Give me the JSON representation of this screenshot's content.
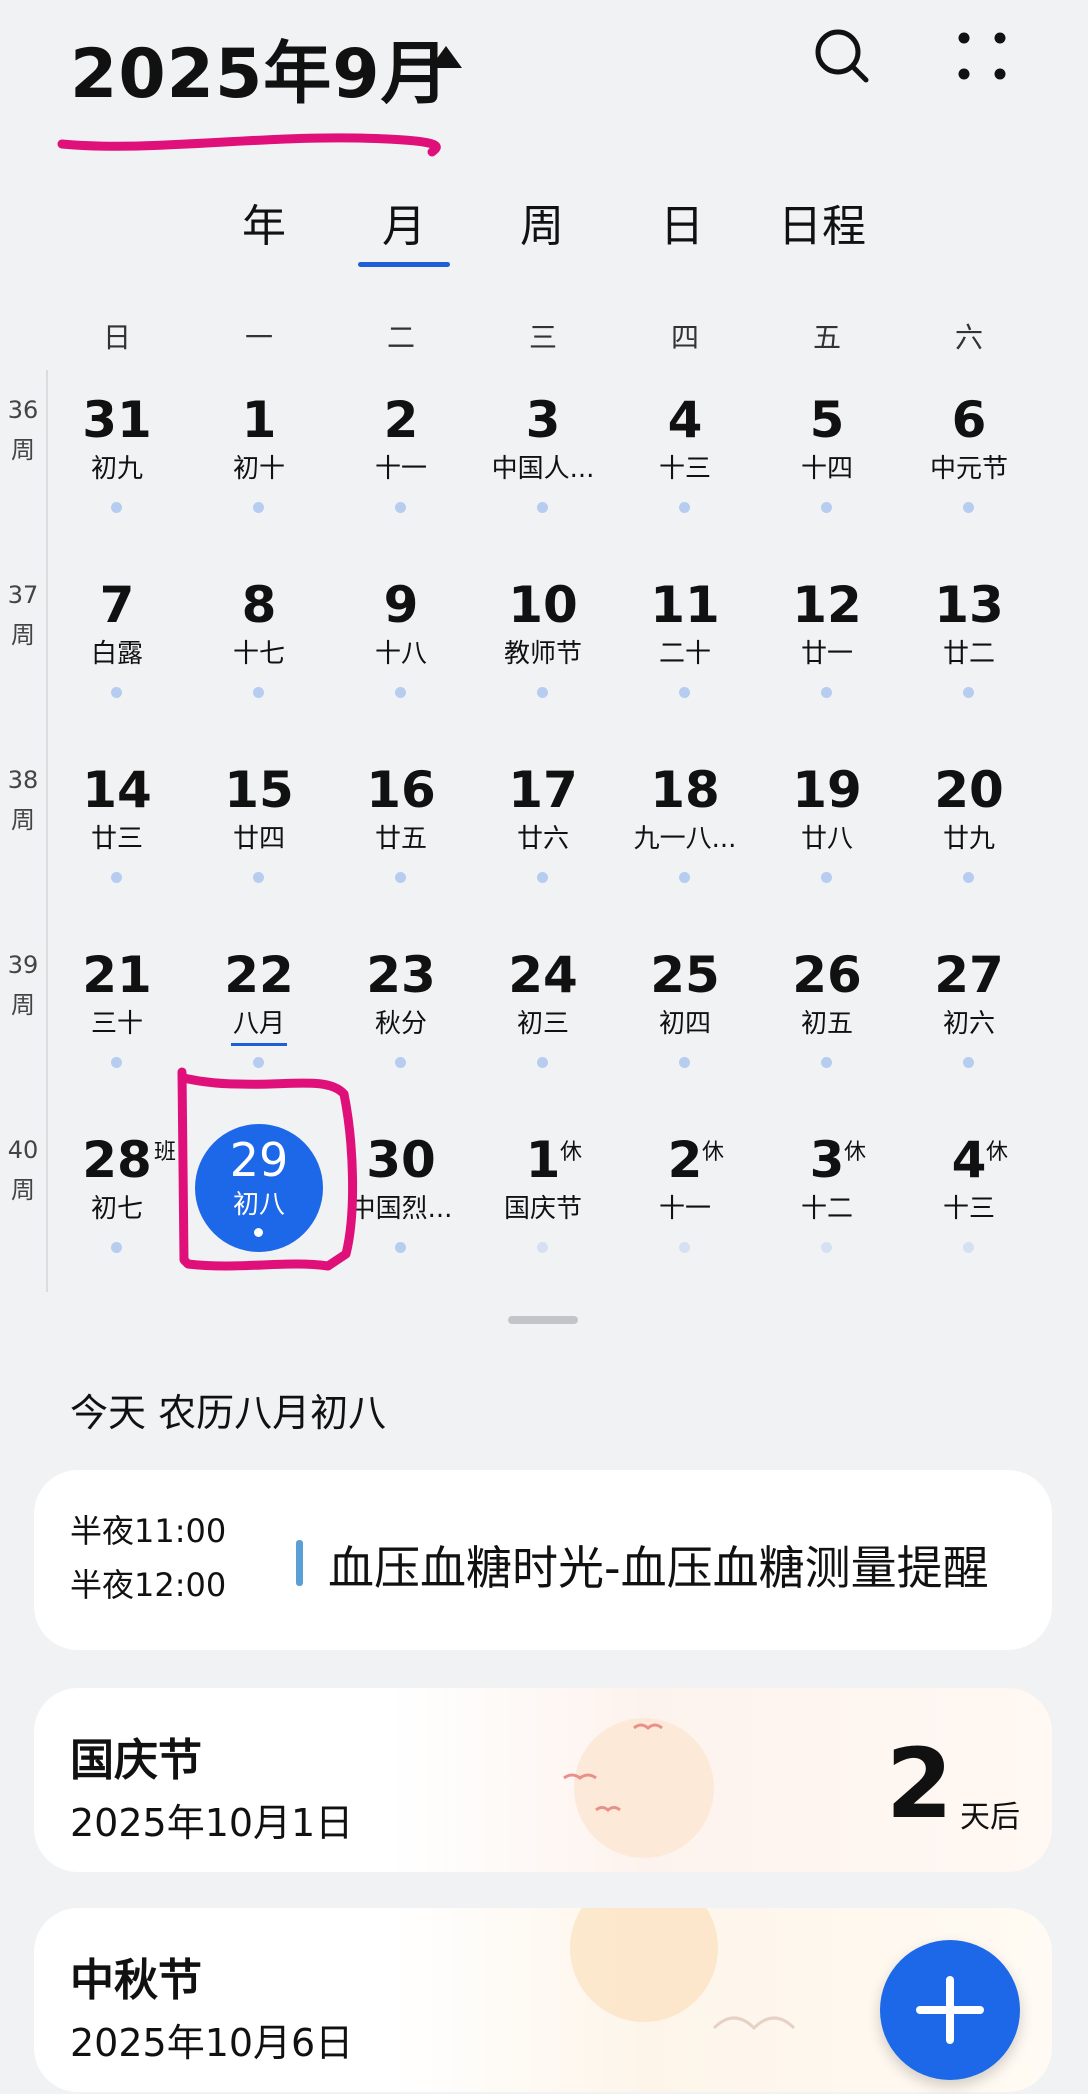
{
  "header": {
    "title": "2025年9月"
  },
  "tabs": [
    {
      "label": "年"
    },
    {
      "label": "月"
    },
    {
      "label": "周"
    },
    {
      "label": "日"
    },
    {
      "label": "日程"
    }
  ],
  "active_tab": "月",
  "weekdays": [
    "日",
    "一",
    "二",
    "三",
    "四",
    "五",
    "六"
  ],
  "week_suffix": "周",
  "weeks": [
    {
      "num": "36",
      "days": [
        {
          "d": "31",
          "l": "初九"
        },
        {
          "d": "1",
          "l": "初十"
        },
        {
          "d": "2",
          "l": "十一"
        },
        {
          "d": "3",
          "l": "中国人..."
        },
        {
          "d": "4",
          "l": "十三"
        },
        {
          "d": "5",
          "l": "十四"
        },
        {
          "d": "6",
          "l": "中元节"
        }
      ]
    },
    {
      "num": "37",
      "days": [
        {
          "d": "7",
          "l": "白露"
        },
        {
          "d": "8",
          "l": "十七"
        },
        {
          "d": "9",
          "l": "十八"
        },
        {
          "d": "10",
          "l": "教师节"
        },
        {
          "d": "11",
          "l": "二十"
        },
        {
          "d": "12",
          "l": "廿一"
        },
        {
          "d": "13",
          "l": "廿二"
        }
      ]
    },
    {
      "num": "38",
      "days": [
        {
          "d": "14",
          "l": "廿三"
        },
        {
          "d": "15",
          "l": "廿四"
        },
        {
          "d": "16",
          "l": "廿五"
        },
        {
          "d": "17",
          "l": "廿六"
        },
        {
          "d": "18",
          "l": "九一八..."
        },
        {
          "d": "19",
          "l": "廿八"
        },
        {
          "d": "20",
          "l": "廿九"
        }
      ]
    },
    {
      "num": "39",
      "days": [
        {
          "d": "21",
          "l": "三十"
        },
        {
          "d": "22",
          "l": "八月",
          "underline": true
        },
        {
          "d": "23",
          "l": "秋分"
        },
        {
          "d": "24",
          "l": "初三"
        },
        {
          "d": "25",
          "l": "初四"
        },
        {
          "d": "26",
          "l": "初五"
        },
        {
          "d": "27",
          "l": "初六"
        }
      ]
    },
    {
      "num": "40",
      "days": [
        {
          "d": "28",
          "l": "初七",
          "tag": "班"
        },
        {
          "d": "29",
          "l": "初八",
          "today": true
        },
        {
          "d": "30",
          "l": "中国烈..."
        },
        {
          "d": "1",
          "l": "国庆节",
          "tag": "休",
          "next": true
        },
        {
          "d": "2",
          "l": "十一",
          "tag": "休",
          "next": true
        },
        {
          "d": "3",
          "l": "十二",
          "tag": "休",
          "next": true
        },
        {
          "d": "4",
          "l": "十三",
          "tag": "休",
          "next": true
        }
      ]
    }
  ],
  "today_label": "今天 农历八月初八",
  "event": {
    "start": "半夜11:00",
    "end": "半夜12:00",
    "title": "血压血糖时光-血压血糖测量提醒",
    "color": "#5aa0d6"
  },
  "holidays": [
    {
      "name": "国庆节",
      "date": "2025年10月1日",
      "count": "2",
      "unit": "天后"
    },
    {
      "name": "中秋节",
      "date": "2025年10月6日",
      "count": "",
      "unit": ""
    }
  ],
  "colors": {
    "accent": "#1c68e8",
    "annotation": "#e0107a",
    "dot": "#b6cdf0"
  },
  "icons": {
    "search": "search-icon",
    "more": "more-grid-icon",
    "add": "plus-icon"
  }
}
